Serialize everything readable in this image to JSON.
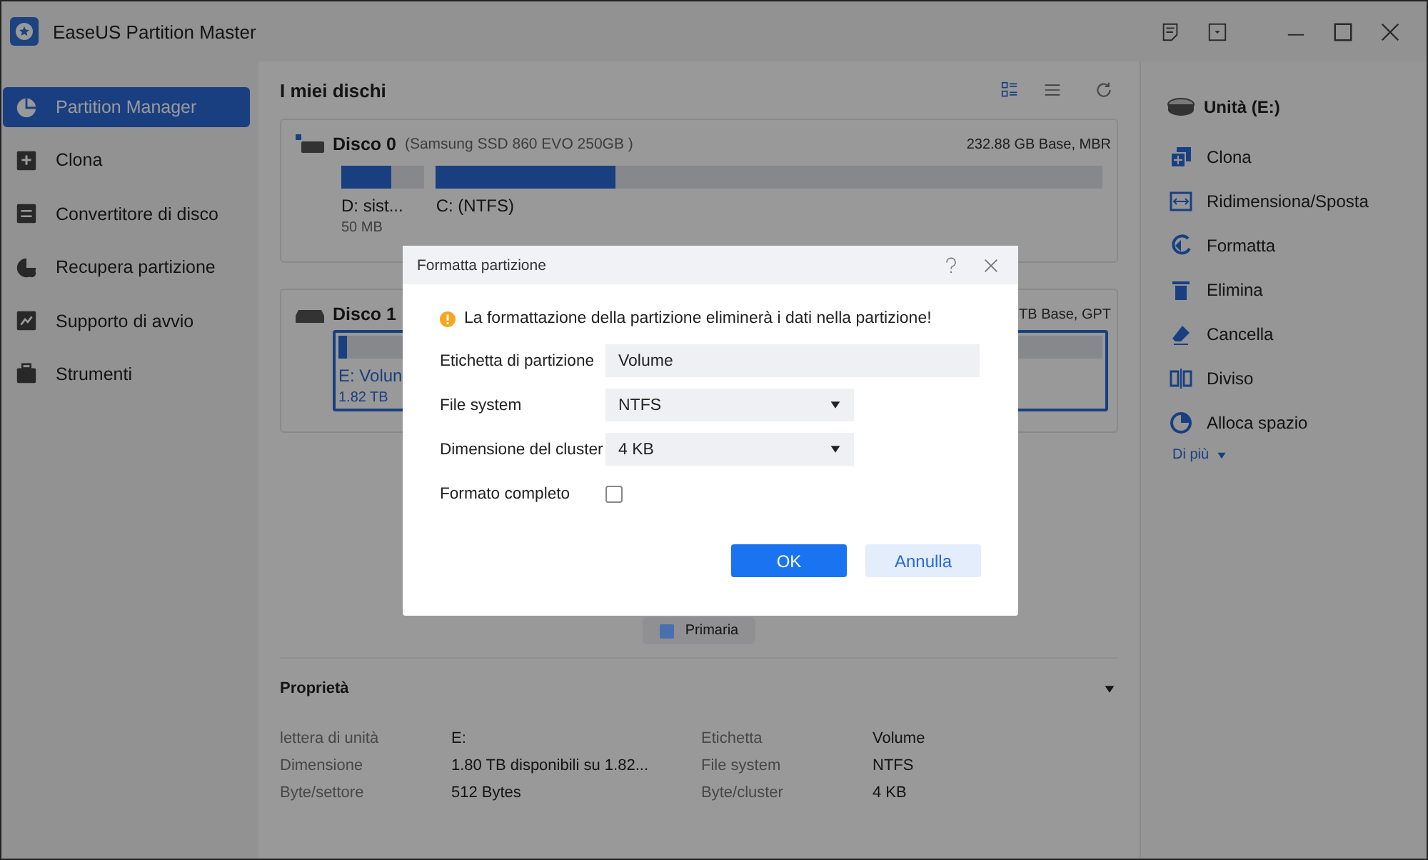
{
  "window": {
    "title": "EaseUS Partition Master"
  },
  "sidebar": {
    "items": [
      {
        "label": "Partition Manager",
        "selected": true
      },
      {
        "label": "Clona",
        "selected": false
      },
      {
        "label": "Convertitore di disco",
        "selected": false
      },
      {
        "label": "Recupera partizione",
        "selected": false
      },
      {
        "label": "Supporto di avvio",
        "selected": false
      },
      {
        "label": "Strumenti",
        "selected": false
      }
    ]
  },
  "main": {
    "title": "I miei dischi",
    "disks": [
      {
        "name": "Disco 0",
        "model": "(Samsung SSD 860 EVO 250GB )",
        "info": "232.88 GB Base, MBR",
        "partitions": [
          {
            "label": "D: sist...",
            "size": "50 MB",
            "level": 0.6,
            "selected": false
          },
          {
            "label": "C: (NTFS)",
            "level": 0.27,
            "selected": false
          }
        ]
      },
      {
        "name": "Disco 1",
        "info": "TB Base, GPT",
        "partitions": [
          {
            "label": "E: Volun",
            "size": "1.82 TB",
            "level": 0.012,
            "selected": true
          }
        ]
      }
    ],
    "legend": [
      {
        "label": "Primaria",
        "color": "#4a6fb0"
      }
    ],
    "properties": {
      "title": "Proprietà",
      "rows": [
        {
          "label": "lettera di unità",
          "value": "E:",
          "label2": "Etichetta",
          "value2": "Volume"
        },
        {
          "label": "Dimensione",
          "value": "1.80 TB disponibili su 1.82...",
          "label2": "File system",
          "value2": "NTFS"
        },
        {
          "label": "Byte/settore",
          "value": "512 Bytes",
          "label2": "Byte/cluster",
          "value2": "4 KB"
        }
      ]
    }
  },
  "actions": {
    "drive": "Unità (E:)",
    "items": [
      {
        "label": "Clona"
      },
      {
        "label": "Ridimensiona/Sposta"
      },
      {
        "label": "Formatta"
      },
      {
        "label": "Elimina"
      },
      {
        "label": "Cancella"
      },
      {
        "label": "Diviso"
      },
      {
        "label": "Alloca spazio"
      }
    ],
    "more": "Di più"
  },
  "dialog": {
    "title": "Formatta partizione",
    "warning": "La formattazione della partizione eliminerà i dati nella partizione!",
    "fields": [
      {
        "kind": "text",
        "label": "Etichetta di partizione",
        "value": "Volume"
      },
      {
        "kind": "select",
        "label": "File system",
        "value": "NTFS"
      },
      {
        "kind": "select",
        "label": "Dimensione del cluster",
        "value": "4 KB"
      },
      {
        "kind": "checkbox",
        "label": "Formato completo",
        "checked": false
      }
    ],
    "ok": "OK",
    "cancel": "Annulla"
  }
}
